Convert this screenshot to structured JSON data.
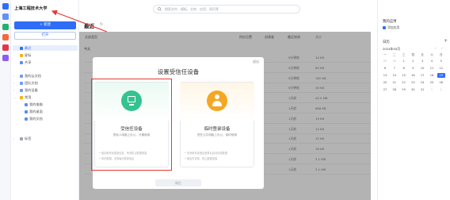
{
  "app": {
    "brand": "上海工程技术大学"
  },
  "sidebar": {
    "new_button": "+ 新建",
    "open_button": "打开",
    "items": [
      {
        "label": "最近"
      },
      {
        "label": "星标"
      },
      {
        "label": "共享"
      },
      {
        "label": "我的云文档"
      },
      {
        "label": "团队文档"
      },
      {
        "label": "我的设备"
      },
      {
        "label": "常用"
      },
      {
        "label": "我的电脑"
      },
      {
        "label": "我的桌面"
      },
      {
        "label": "我的文档"
      },
      {
        "label": "标签"
      }
    ]
  },
  "search": {
    "placeholder": "搜索文件、模板、文库、应用、网页等"
  },
  "main": {
    "title": "最近",
    "columns": [
      "全部类型",
      "所在位置",
      "创建者",
      "最近修改",
      "大小"
    ],
    "group_today": "今天",
    "rows": [
      {
        "time": "5分钟前",
        "size": "14 KB"
      },
      {
        "time": "5分钟前",
        "size": "80 KB"
      },
      {
        "time": "5分钟前",
        "size": "162 KB"
      },
      {
        "time": "5分钟前",
        "size": "16 KB"
      },
      {
        "time": "1天前",
        "size": "42.0 MB"
      },
      {
        "time": "1天前",
        "size": "868 KB"
      },
      {
        "time": "1天前",
        "size": "19 KB"
      },
      {
        "time": "1天前",
        "size": "14 KB"
      },
      {
        "time": "1天前",
        "size": "15 KB"
      },
      {
        "time": "1天前",
        "size": "16 KB"
      },
      {
        "time": "1天前",
        "size": "3.1 MB"
      },
      {
        "time": "1天前",
        "size": "3.1 MB"
      }
    ]
  },
  "modal": {
    "title": "设置受信任设备",
    "close": "退出",
    "trusted": {
      "title": "受信任设备",
      "subtitle": "您私人电脑上办公，长期使用",
      "notes": [
        "• 保存账号及登录信息，有效防止数据泄露",
        "• 同步数据，无需每次登录验证"
      ]
    },
    "temporary": {
      "title": "临时登录设备",
      "subtitle": "您在公共电脑上办公，临时使用",
      "notes": [
        "• 关闭软件或退出登录后自动清除数据",
        "• 退出时清除，防止数据泄露"
      ]
    },
    "confirm": "确定"
  },
  "right_panel": {
    "apps_title": "我的应用",
    "app_item": "添加应用",
    "calendar_title": "日历",
    "month": "2024年05月",
    "weekdays": [
      "一",
      "二",
      "三",
      "四",
      "五",
      "六",
      "日"
    ],
    "weeks": [
      [
        "29",
        "30",
        "1",
        "2",
        "3",
        "4",
        "5"
      ],
      [
        "6",
        "7",
        "8",
        "9",
        "10",
        "11",
        "12"
      ],
      [
        "13",
        "14",
        "15",
        "16",
        "17",
        "18",
        "19"
      ],
      [
        "20",
        "21",
        "22",
        "23",
        "24",
        "25",
        "26"
      ],
      [
        "27",
        "28",
        "29",
        "30",
        "31",
        "1",
        "2"
      ]
    ],
    "today": "19"
  },
  "colors": {
    "accent": "#2f6df6",
    "highlight_red": "#e53935",
    "trusted_green": "#34c38f",
    "temp_orange": "#f5a623"
  }
}
